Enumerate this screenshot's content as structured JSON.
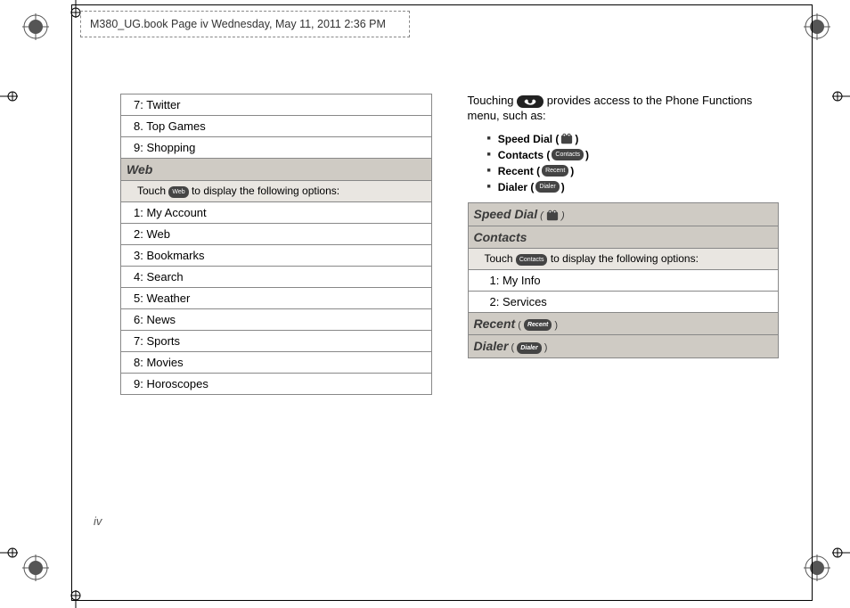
{
  "header_note": "M380_UG.book  Page iv  Wednesday, May 11, 2011  2:36 PM",
  "page_number": "iv",
  "left_column": {
    "items_top": [
      "7: Twitter",
      "8. Top Games",
      "9: Shopping"
    ],
    "section": "Web",
    "section_sub_prefix": "Touch ",
    "section_sub_icon": "Web",
    "section_sub_suffix": " to display the following options:",
    "items_bottom": [
      "1: My Account",
      "2: Web",
      "3: Bookmarks",
      "4: Search",
      "5: Weather",
      "6: News",
      "7: Sports",
      "8: Movies",
      "9: Horoscopes"
    ]
  },
  "right_column": {
    "intro_prefix": "Touching ",
    "intro_suffix": " provides access to the Phone Functions menu, such as:",
    "bullets": [
      {
        "label": "Speed Dial",
        "icon_type": "speed"
      },
      {
        "label": "Contacts",
        "icon_type": "pill",
        "icon_text": "Contacts"
      },
      {
        "label": "Recent",
        "icon_type": "pill",
        "icon_text": "Recent"
      },
      {
        "label": "Dialer",
        "icon_type": "pill",
        "icon_text": "Dialer"
      }
    ],
    "sections": [
      {
        "title": "Speed Dial",
        "icon_type": "speed"
      },
      {
        "title": "Contacts",
        "icon_type": "none",
        "sub_prefix": "Touch ",
        "sub_icon": "Contacts",
        "sub_suffix": " to display the following options:",
        "items": [
          "1: My Info",
          "2: Services"
        ]
      },
      {
        "title": "Recent",
        "icon_type": "pill",
        "icon_text": "Recent"
      },
      {
        "title": "Dialer",
        "icon_type": "pill",
        "icon_text": "Dialer"
      }
    ]
  }
}
